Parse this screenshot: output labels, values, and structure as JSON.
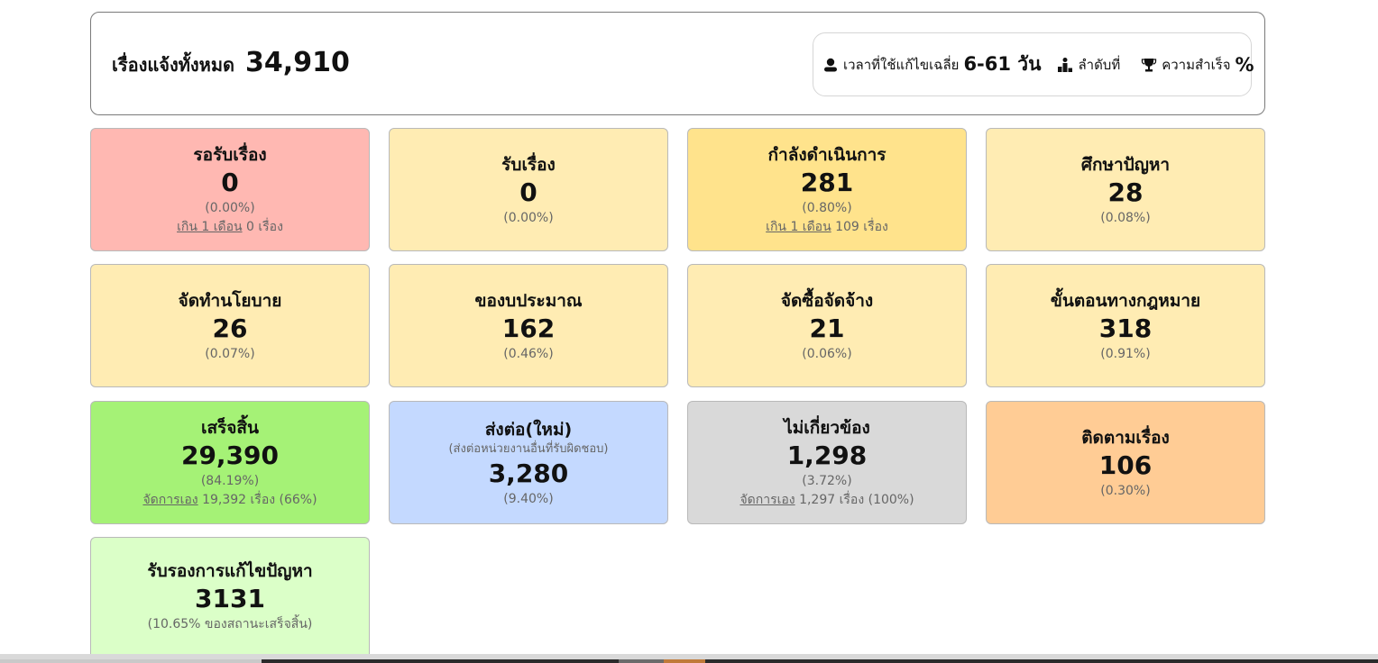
{
  "summary": {
    "label": "เรื่องแจ้งทั้งหมด",
    "total": "34,910",
    "metrics": {
      "avg_time_label": "เวลาที่ใช้แก้ไขเฉลี่ย",
      "avg_time_value": "6-61 วัน",
      "rank_label": "ลำดับที่",
      "rank_value": "",
      "success_label": "ความสำเร็จ",
      "success_value": "%"
    }
  },
  "cards": [
    {
      "title": "รอรับเรื่อง",
      "count": "0",
      "pct": "(0.00%)",
      "note_link": "เกิน 1 เดือน",
      "note_text": " 0 เรื่อง",
      "color": "#ffb8b2"
    },
    {
      "title": "รับเรื่อง",
      "count": "0",
      "pct": "(0.00%)",
      "color": "#ffecb3"
    },
    {
      "title": "กำลังดำเนินการ",
      "count": "281",
      "pct": "(0.80%)",
      "note_link": "เกิน 1 เดือน",
      "note_text": " 109 เรื่อง",
      "color": "#ffe38c"
    },
    {
      "title": "ศึกษาปัญหา",
      "count": "28",
      "pct": "(0.08%)",
      "color": "#ffecb3"
    },
    {
      "title": "จัดทำนโยบาย",
      "count": "26",
      "pct": "(0.07%)",
      "color": "#ffecb3"
    },
    {
      "title": "ของบประมาณ",
      "count": "162",
      "pct": "(0.46%)",
      "color": "#ffecb3"
    },
    {
      "title": "จัดซื้อจัดจ้าง",
      "count": "21",
      "pct": "(0.06%)",
      "color": "#ffecb3"
    },
    {
      "title": "ขั้นตอนทางกฎหมาย",
      "count": "318",
      "pct": "(0.91%)",
      "color": "#ffecb3"
    },
    {
      "title": "เสร็จสิ้น",
      "count": "29,390",
      "pct": "(84.19%)",
      "note_link": "จัดการเอง",
      "note_text": " 19,392 เรื่อง (66%)",
      "color": "#a5f276"
    },
    {
      "title": "ส่งต่อ(ใหม่)",
      "subtitle": "(ส่งต่อหน่วยงานอื่นที่รับผิดชอบ)",
      "count": "3,280",
      "pct": "(9.40%)",
      "color": "#c4d9ff"
    },
    {
      "title": "ไม่เกี่ยวข้อง",
      "count": "1,298",
      "pct": "(3.72%)",
      "note_link": "จัดการเอง",
      "note_text": " 1,297 เรื่อง (100%)",
      "color": "#d9d9d9"
    },
    {
      "title": "ติดตามเรื่อง",
      "count": "106",
      "pct": "(0.30%)",
      "color": "#ffcc95"
    },
    {
      "title": "รับรองการแก้ไขปัญหา",
      "count": "3131",
      "pct": "(10.65% ของสถานะเสร็จสิ้น)",
      "color": "#dbffc8"
    }
  ]
}
